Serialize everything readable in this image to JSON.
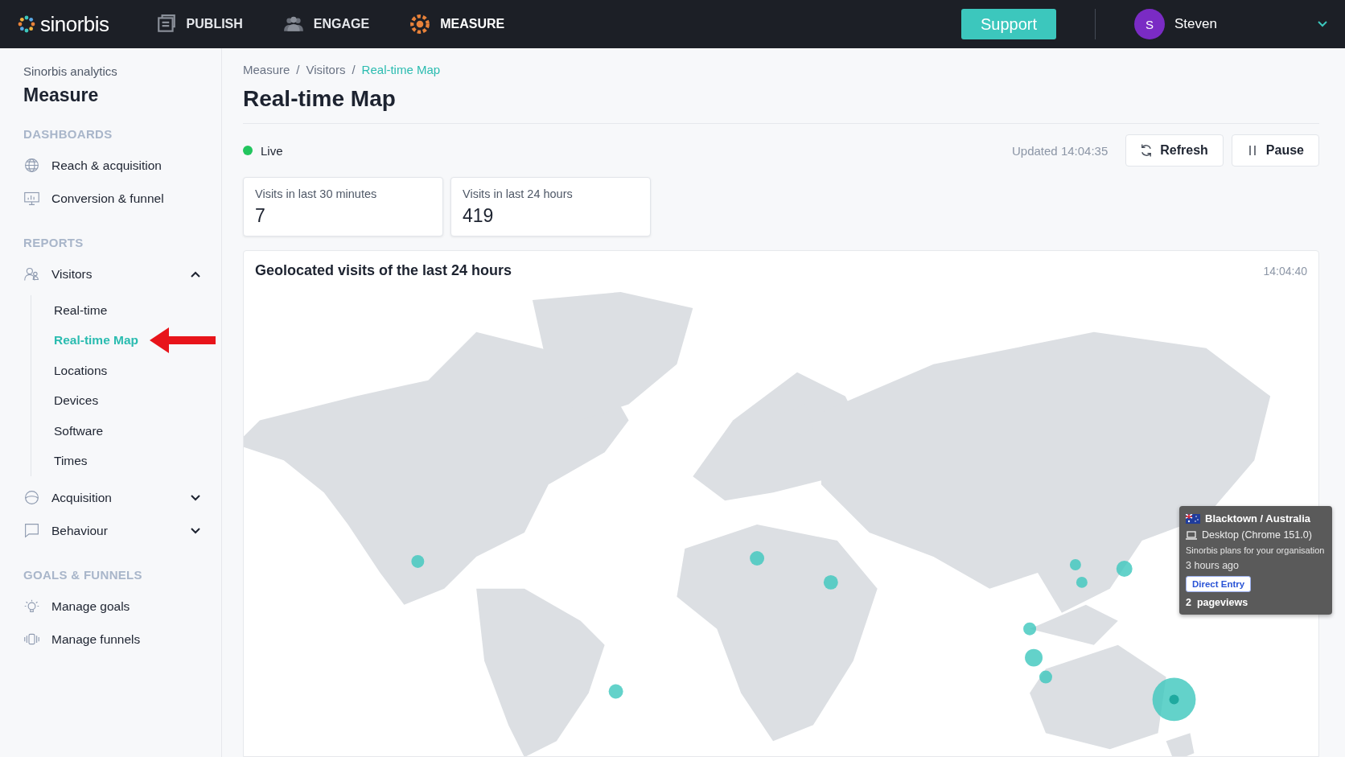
{
  "topbar": {
    "logo": "sinorbis",
    "nav": [
      {
        "label": "PUBLISH",
        "kind": "publish",
        "selected": false
      },
      {
        "label": "ENGAGE",
        "kind": "engage",
        "selected": false
      },
      {
        "label": "MEASURE",
        "kind": "measure",
        "selected": true
      }
    ],
    "support": "Support",
    "user": {
      "initial": "S",
      "name": "Steven"
    }
  },
  "sidebar": {
    "subtitle": "Sinorbis analytics",
    "title": "Measure",
    "sections": [
      {
        "heading": "DASHBOARDS",
        "items": [
          {
            "label": "Reach & acquisition",
            "kind": "globe",
            "selected": false
          },
          {
            "label": "Conversion & funnel",
            "kind": "chart",
            "selected": false
          }
        ]
      },
      {
        "heading": "REPORTS",
        "items": [
          {
            "label": "Visitors",
            "kind": "users",
            "selected": false,
            "expanded": true,
            "children": [
              {
                "label": "Real-time",
                "selected": false
              },
              {
                "label": "Real-time Map",
                "selected": true
              },
              {
                "label": "Locations",
                "selected": false
              },
              {
                "label": "Devices",
                "selected": false
              },
              {
                "label": "Software",
                "selected": false
              },
              {
                "label": "Times",
                "selected": false
              }
            ]
          },
          {
            "label": "Acquisition",
            "kind": "circle",
            "selected": false,
            "expanded": false
          },
          {
            "label": "Behaviour",
            "kind": "chat",
            "selected": false,
            "expanded": false
          }
        ]
      },
      {
        "heading": "GOALS & FUNNELS",
        "items": [
          {
            "label": "Manage goals",
            "kind": "bulb",
            "selected": false
          },
          {
            "label": "Manage funnels",
            "kind": "funnel",
            "selected": false
          }
        ]
      }
    ]
  },
  "main": {
    "breadcrumb": [
      {
        "label": "Measure",
        "selected": false
      },
      {
        "separator": "/",
        "label": "Visitors",
        "selected": false
      },
      {
        "separator": "/",
        "label": "Real-time Map",
        "selected": true
      }
    ],
    "title": "Real-time Map",
    "live": {
      "label": "Live",
      "on": true
    },
    "updated": "Updated 14:04:35",
    "buttons": [
      {
        "label": "Refresh",
        "kind": "refresh"
      },
      {
        "label": "Pause",
        "kind": "pause"
      }
    ],
    "stats": [
      {
        "label": "Visits in last 30 minutes",
        "value": "7"
      },
      {
        "label": "Visits in last 24 hours",
        "value": "419"
      }
    ],
    "map": {
      "title": "Geolocated visits of the last 24 hours",
      "time": "14:04:40",
      "tooltip": {
        "place": "Blacktown / Australia",
        "device": "Desktop (Chrome 151.0)",
        "site": "Sinorbis plans for your organisation",
        "ago": "3 hours ago",
        "tag": "Direct Entry",
        "pageviews": "2  pageviews"
      }
    }
  }
}
